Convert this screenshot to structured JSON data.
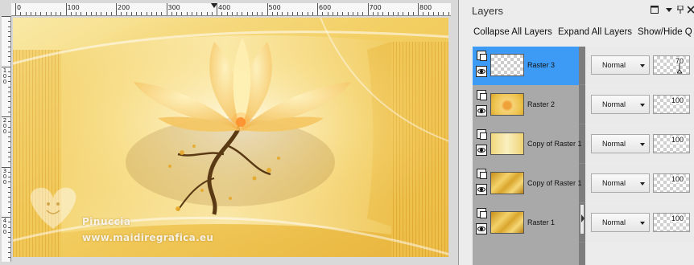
{
  "colors": {
    "selected_row": "#3d9bf5",
    "layer_column": "#a9a9a9",
    "canvas_gold": "#f2c75a"
  },
  "canvas": {
    "ruler_h_labels": [
      "0",
      "100",
      "200",
      "300",
      "400",
      "500",
      "600",
      "700",
      "800"
    ],
    "ruler_v_labels": [
      "1\n0\n0",
      "2\n0\n0",
      "3\n0\n0",
      "4\n0\n0"
    ],
    "watermark": {
      "line1": "Pinuccia",
      "line2": "www.maidiregrafica.eu"
    }
  },
  "layers_panel": {
    "title": "Layers",
    "window_controls": {
      "restore_icon": "maximize-icon",
      "menu_icon": "dropdown-arrow-icon",
      "pin_icon": "pin-icon",
      "close_icon": "close-icon"
    },
    "toolbar": {
      "collapse_label": "Collapse All Layers",
      "expand_label": "Expand All Layers",
      "showhide_label": "Show/Hide Q"
    },
    "layers": [
      {
        "name": "Raster 3",
        "blend_mode": "Normal",
        "opacity": "70",
        "selected": true,
        "thumb": "transparent"
      },
      {
        "name": "Raster 2",
        "blend_mode": "Normal",
        "opacity": "100",
        "selected": false,
        "thumb": "flower"
      },
      {
        "name": "Copy of Raster 1",
        "blend_mode": "Normal",
        "opacity": "100",
        "selected": false,
        "thumb": "copy1"
      },
      {
        "name": "Copy of Raster 1",
        "blend_mode": "Normal",
        "opacity": "100",
        "selected": false,
        "thumb": "gold"
      },
      {
        "name": "Raster 1",
        "blend_mode": "Normal",
        "opacity": "100",
        "selected": false,
        "thumb": "gold"
      }
    ]
  }
}
